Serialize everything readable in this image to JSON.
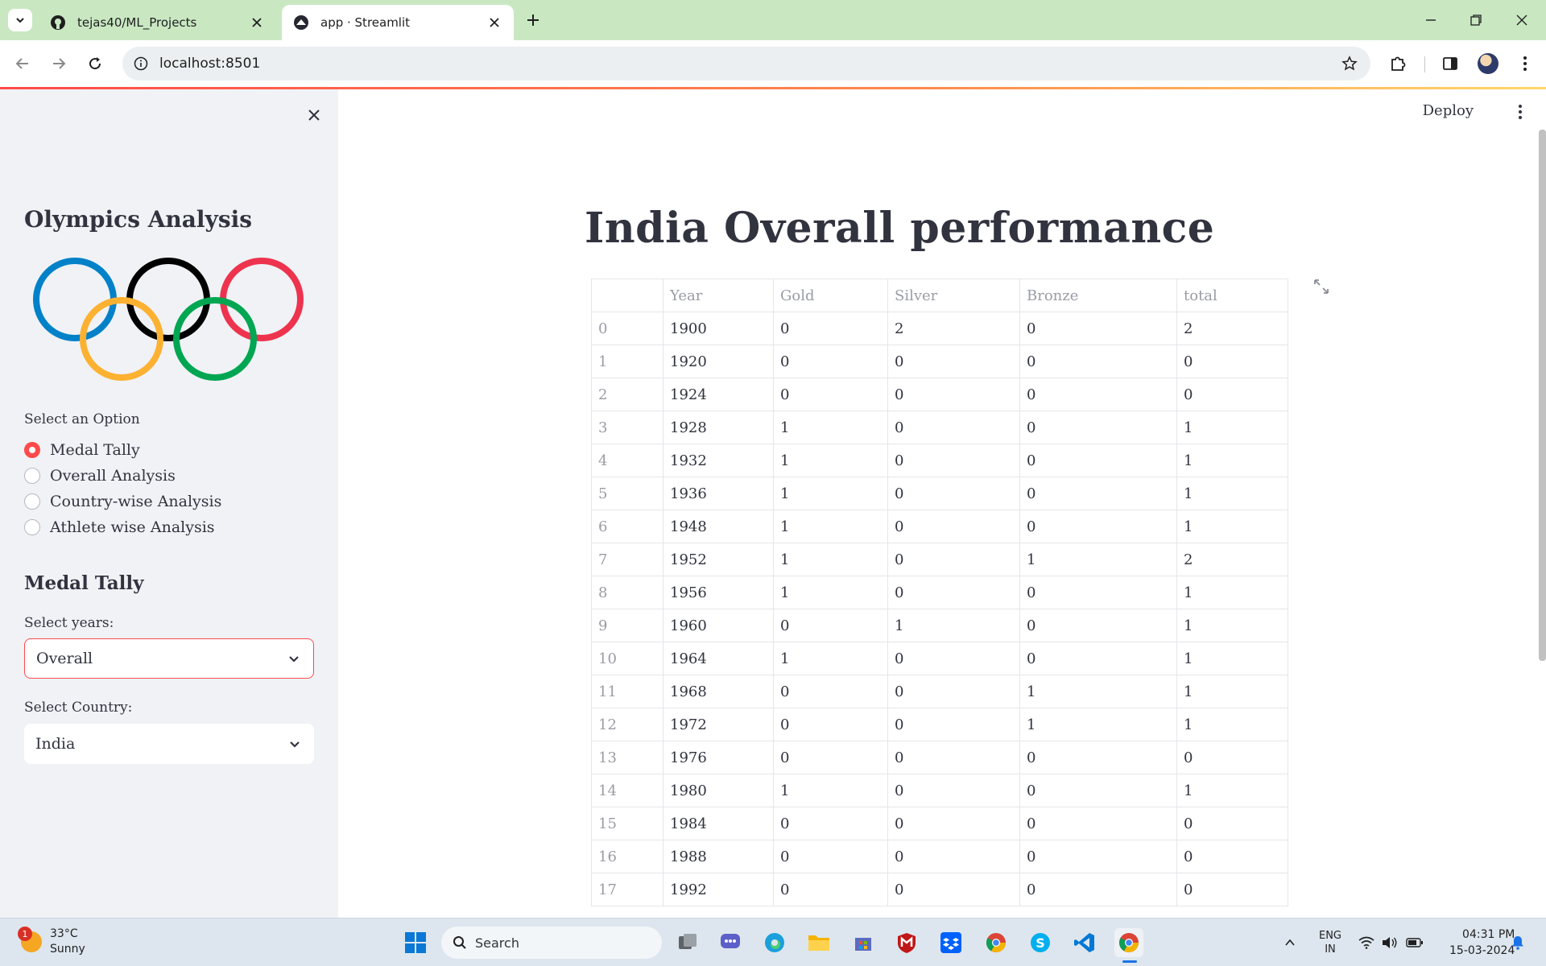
{
  "browser": {
    "tabs": [
      {
        "title": "tejas40/ML_Projects",
        "active": false,
        "favicon": "github-icon"
      },
      {
        "title": "app · Streamlit",
        "active": true,
        "favicon": "streamlit-icon"
      }
    ],
    "url": "localhost:8501"
  },
  "sidebar": {
    "title": "Olympics Analysis",
    "option_label": "Select an Option",
    "options": [
      "Medal Tally",
      "Overall Analysis",
      "Country-wise Analysis",
      "Athlete wise Analysis"
    ],
    "selected_option": "Medal Tally",
    "subheader": "Medal Tally",
    "year_label": "Select years:",
    "year_value": "Overall",
    "country_label": "Select Country:",
    "country_value": "India"
  },
  "header": {
    "deploy_label": "Deploy"
  },
  "main": {
    "title": "India Overall performance",
    "table": {
      "columns": [
        "",
        "Year",
        "Gold",
        "Silver",
        "Bronze",
        "total"
      ],
      "rows": [
        [
          "0",
          "1900",
          "0",
          "2",
          "0",
          "2"
        ],
        [
          "1",
          "1920",
          "0",
          "0",
          "0",
          "0"
        ],
        [
          "2",
          "1924",
          "0",
          "0",
          "0",
          "0"
        ],
        [
          "3",
          "1928",
          "1",
          "0",
          "0",
          "1"
        ],
        [
          "4",
          "1932",
          "1",
          "0",
          "0",
          "1"
        ],
        [
          "5",
          "1936",
          "1",
          "0",
          "0",
          "1"
        ],
        [
          "6",
          "1948",
          "1",
          "0",
          "0",
          "1"
        ],
        [
          "7",
          "1952",
          "1",
          "0",
          "1",
          "2"
        ],
        [
          "8",
          "1956",
          "1",
          "0",
          "0",
          "1"
        ],
        [
          "9",
          "1960",
          "0",
          "1",
          "0",
          "1"
        ],
        [
          "10",
          "1964",
          "1",
          "0",
          "0",
          "1"
        ],
        [
          "11",
          "1968",
          "0",
          "0",
          "1",
          "1"
        ],
        [
          "12",
          "1972",
          "0",
          "0",
          "1",
          "1"
        ],
        [
          "13",
          "1976",
          "0",
          "0",
          "0",
          "0"
        ],
        [
          "14",
          "1980",
          "1",
          "0",
          "0",
          "1"
        ],
        [
          "15",
          "1984",
          "0",
          "0",
          "0",
          "0"
        ],
        [
          "16",
          "1988",
          "0",
          "0",
          "0",
          "0"
        ],
        [
          "17",
          "1992",
          "0",
          "0",
          "0",
          "0"
        ]
      ]
    }
  },
  "taskbar": {
    "weather_temp": "33°C",
    "weather_desc": "Sunny",
    "weather_badge": "1",
    "search_label": "Search",
    "lang_line1": "ENG",
    "lang_line2": "IN",
    "time": "04:31 PM",
    "date": "15-03-2024"
  },
  "colors": {
    "accent": "#ff4b4b",
    "sidebar_bg": "#f0f2f6",
    "tabbar_bg": "#c9e8c2",
    "rings": [
      "#0081c8",
      "#000000",
      "#ee334e",
      "#fcb131",
      "#00a651"
    ]
  }
}
